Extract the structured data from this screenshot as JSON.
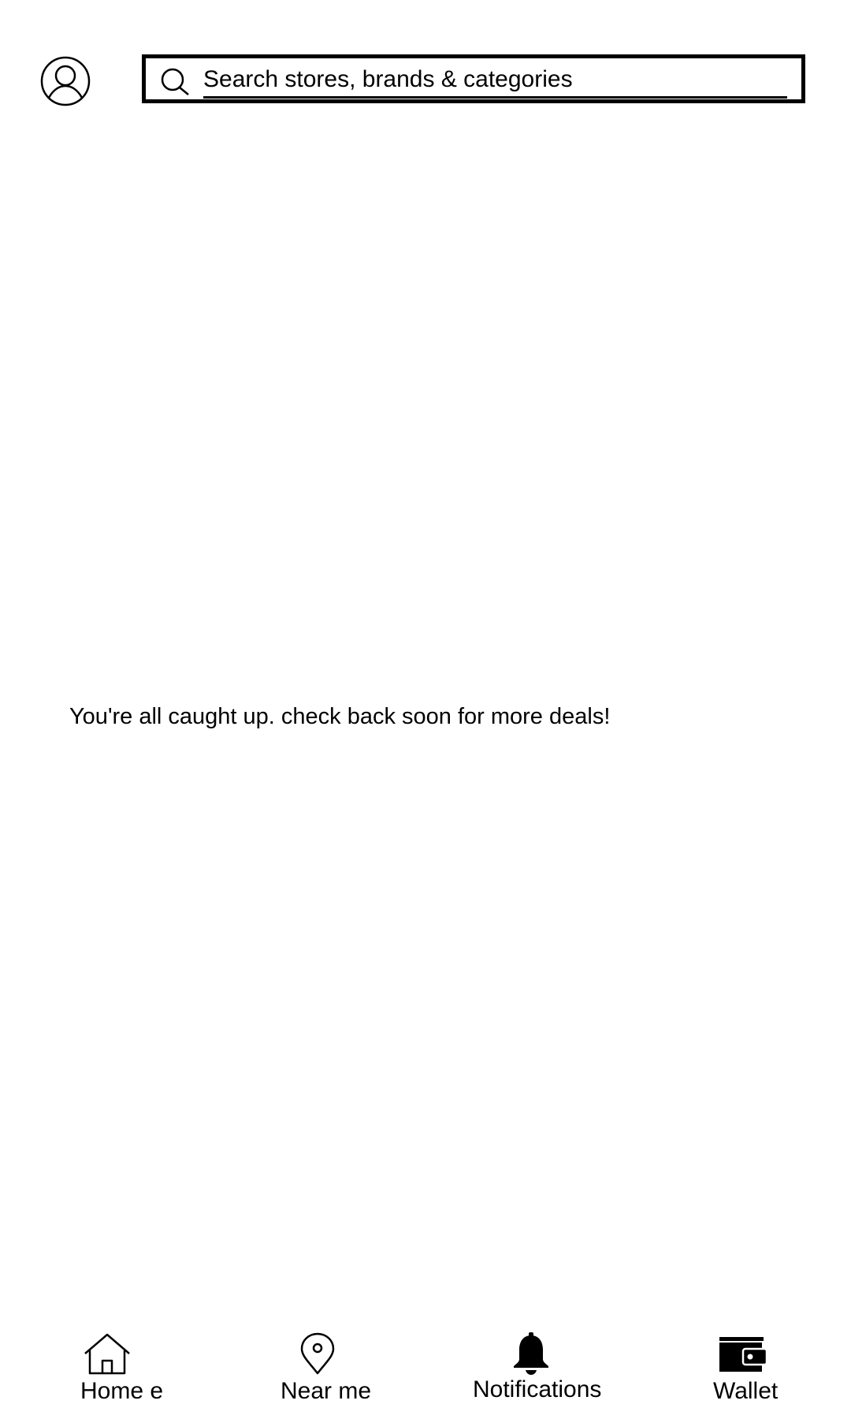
{
  "header": {
    "profile_icon": "user-circle-icon",
    "search": {
      "icon": "search-icon",
      "placeholder": "Search stores, brands & categories"
    }
  },
  "main": {
    "empty_message": "You're all caught up. check back soon for more deals!"
  },
  "bottom_nav": {
    "items": [
      {
        "label": "Home e",
        "icon": "home-icon",
        "active": false
      },
      {
        "label": "Near me",
        "icon": "location-pin-icon",
        "active": false
      },
      {
        "label": "Notifications",
        "icon": "bell-icon",
        "active": true
      },
      {
        "label": "Wallet",
        "icon": "wallet-icon",
        "active": false
      }
    ]
  },
  "colors": {
    "foreground": "#000000",
    "background": "#ffffff"
  }
}
